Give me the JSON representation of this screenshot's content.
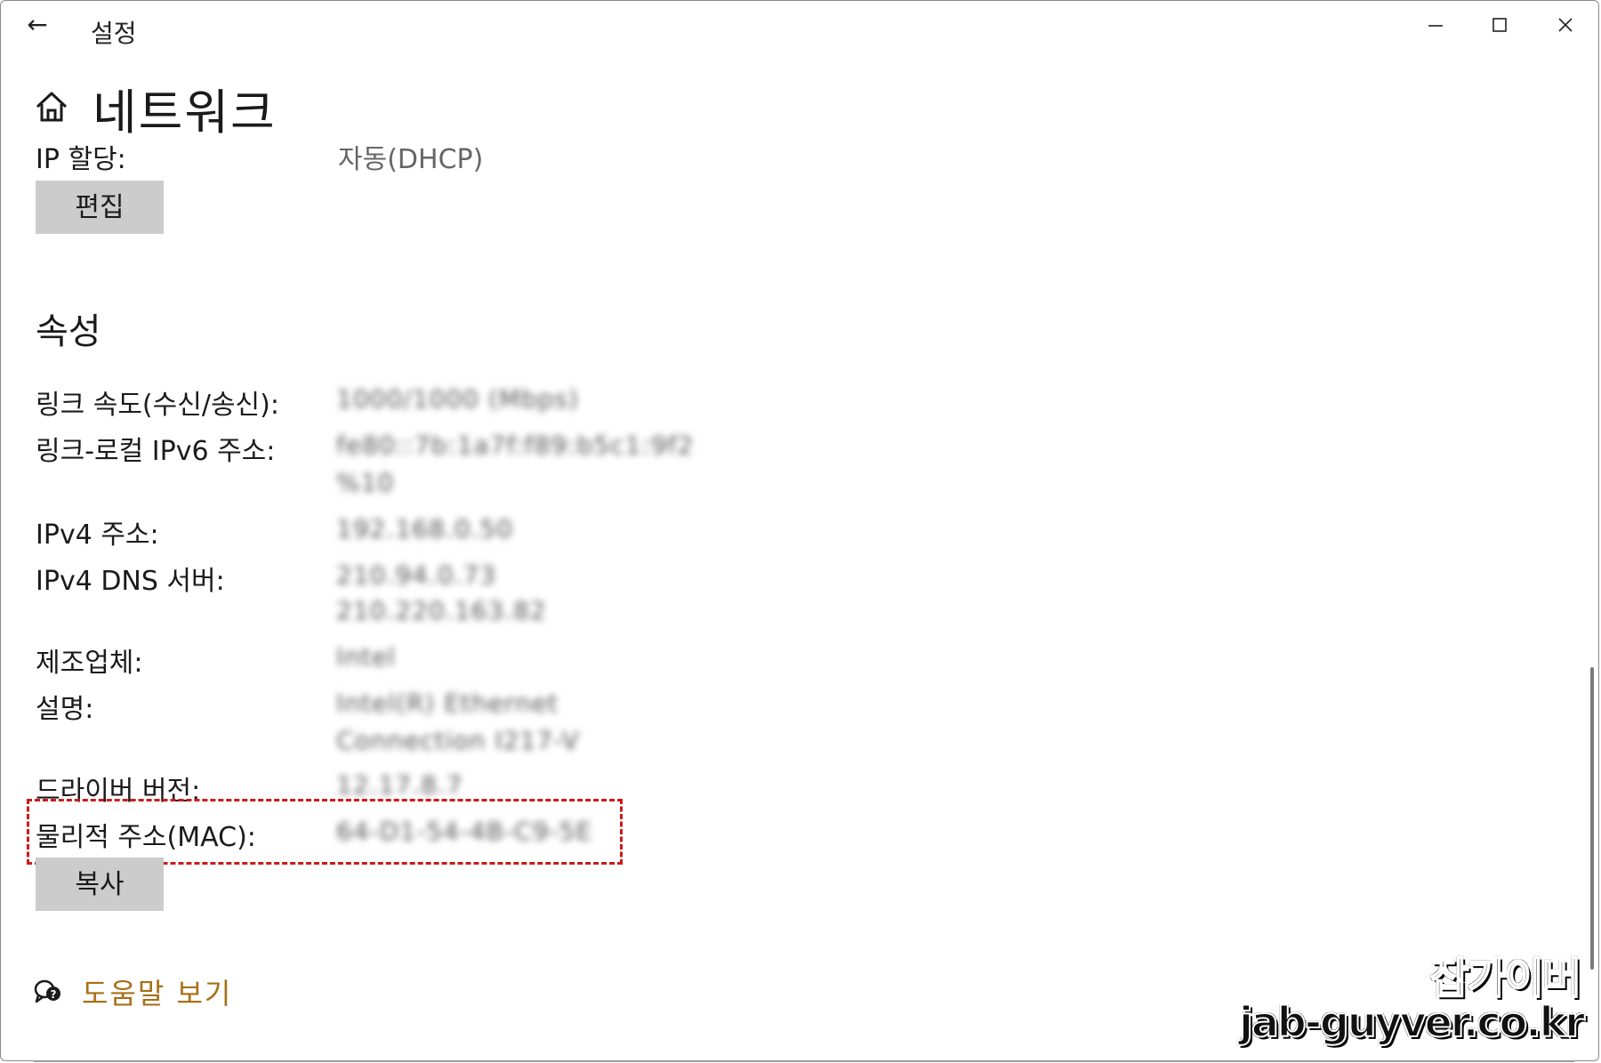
{
  "titlebar": {
    "back_glyph": "←",
    "title": "설정"
  },
  "page": {
    "title": "네트워크"
  },
  "ip": {
    "label": "IP 할당:",
    "value": "자동(DHCP)",
    "edit_button": "편집"
  },
  "properties": {
    "section_title": "속성",
    "link_speed_label": "링크 속도(수신/송신):",
    "link_speed_value": "1000/1000 (Mbps)",
    "ipv6_label": "링크-로컬 IPv6 주소:",
    "ipv6_value_line1": "fe80::7b:1a7f:f89:b5c1:9f2",
    "ipv6_value_line2": "%10",
    "ipv4_label": "IPv4 주소:",
    "ipv4_value": "192.168.0.50",
    "dns_label": "IPv4 DNS 서버:",
    "dns_value_line1": "210.94.0.73",
    "dns_value_line2": "210.220.163.82",
    "manufacturer_label": "제조업체:",
    "manufacturer_value": "Intel",
    "description_label": "설명:",
    "description_line1": "Intel(R) Ethernet",
    "description_line2": "Connection I217-V",
    "driver_label": "드라이버 버전:",
    "driver_value": "12.17.8.7",
    "mac_label": "물리적 주소(MAC):",
    "mac_value": "64-D1-54-4B-C9-5E",
    "copy_button": "복사"
  },
  "help": {
    "link": "도움말 보기"
  },
  "watermark": {
    "line1": "잡가이버",
    "line2": "jab-guyver.co.kr"
  },
  "colors": {
    "button_bg": "#cccccc",
    "link": "#a86f17",
    "highlight": "#cc1a1a"
  },
  "icons": {
    "back": "back-arrow-icon",
    "home": "home-icon",
    "help": "help-chat-icon"
  }
}
